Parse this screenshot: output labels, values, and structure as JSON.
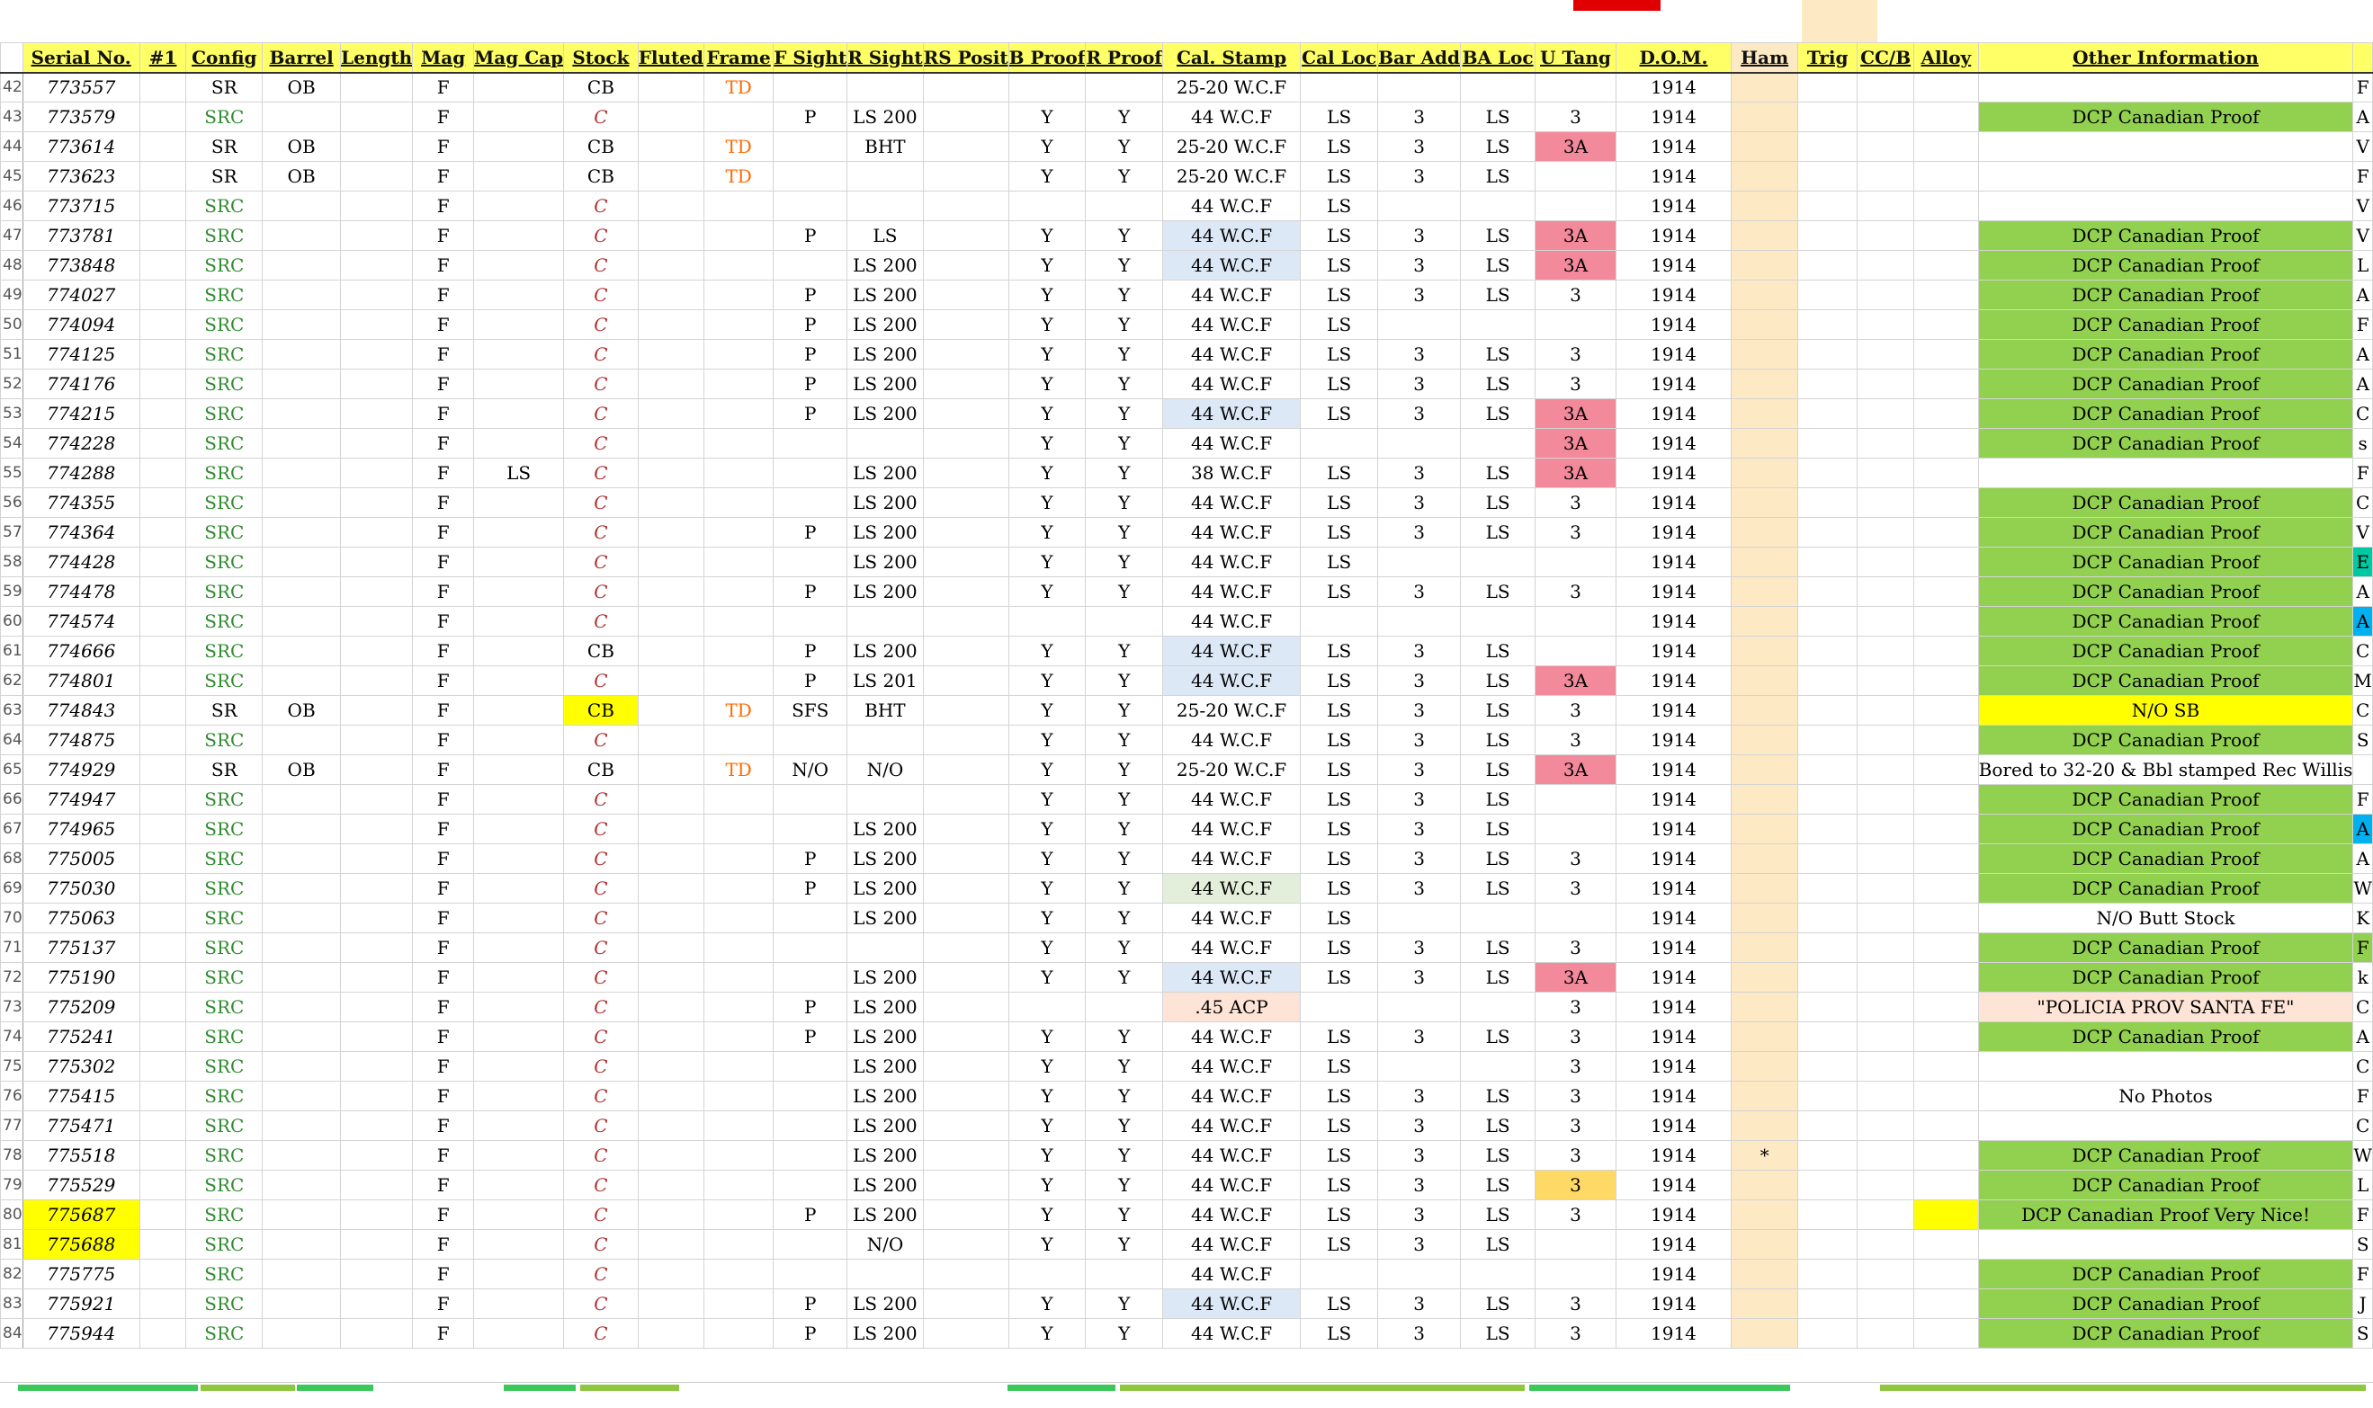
{
  "columns": [
    {
      "key": "rn",
      "label": ""
    },
    {
      "key": "ser",
      "label": "Serial No."
    },
    {
      "key": "num",
      "label": "#1"
    },
    {
      "key": "cfg",
      "label": "Config"
    },
    {
      "key": "bar",
      "label": "Barrel"
    },
    {
      "key": "len",
      "label": "Length"
    },
    {
      "key": "mag",
      "label": "Mag"
    },
    {
      "key": "mcap",
      "label": "Mag Cap"
    },
    {
      "key": "stk",
      "label": "Stock"
    },
    {
      "key": "flu",
      "label": "Fluted"
    },
    {
      "key": "frm",
      "label": "Frame"
    },
    {
      "key": "fs",
      "label": "F Sight"
    },
    {
      "key": "rs",
      "label": "R Sight"
    },
    {
      "key": "rsp",
      "label": "RS Posit"
    },
    {
      "key": "bp",
      "label": "B Proof"
    },
    {
      "key": "rp",
      "label": "R Proof"
    },
    {
      "key": "cal",
      "label": "Cal. Stamp"
    },
    {
      "key": "cl",
      "label": "Cal Loc"
    },
    {
      "key": "ba",
      "label": "Bar Add"
    },
    {
      "key": "bal",
      "label": "BA Loc"
    },
    {
      "key": "ut",
      "label": "U Tang"
    },
    {
      "key": "dom",
      "label": "D.O.M."
    },
    {
      "key": "ham",
      "label": "Ham"
    },
    {
      "key": "trg",
      "label": "Trig"
    },
    {
      "key": "ccb",
      "label": "CC/B"
    },
    {
      "key": "all",
      "label": "Alloy"
    },
    {
      "key": "oth",
      "label": "Other Information"
    },
    {
      "key": "edge",
      "label": ""
    }
  ],
  "rows": [
    {
      "rn": "42",
      "ser": "773557",
      "cfg": "SR",
      "bar": "OB",
      "mag": "F",
      "stk": "CB",
      "frm": "TD",
      "cal": "25-20 W.C.F",
      "dom": "1914",
      "edge": "F"
    },
    {
      "rn": "43",
      "ser": "773579",
      "cfg": "SRC",
      "mag": "F",
      "stk": "C",
      "fs": "P",
      "rs": "LS 200",
      "bp": "Y",
      "rp": "Y",
      "cal": "44 W.C.F",
      "cl": "LS",
      "ba": "3",
      "bal": "LS",
      "ut": "3",
      "dom": "1914",
      "oth": "DCP Canadian Proof",
      "oth_hl": "lime",
      "edge": "A"
    },
    {
      "rn": "44",
      "ser": "773614",
      "cfg": "SR",
      "bar": "OB",
      "mag": "F",
      "stk": "CB",
      "frm": "TD",
      "rs": "BHT",
      "bp": "Y",
      "rp": "Y",
      "cal": "25-20 W.C.F",
      "cl": "LS",
      "ba": "3",
      "bal": "LS",
      "ut": "3A",
      "ut_hl": "red",
      "dom": "1914",
      "edge": "V"
    },
    {
      "rn": "45",
      "ser": "773623",
      "cfg": "SR",
      "bar": "OB",
      "mag": "F",
      "stk": "CB",
      "frm": "TD",
      "bp": "Y",
      "rp": "Y",
      "cal": "25-20 W.C.F",
      "cl": "LS",
      "ba": "3",
      "bal": "LS",
      "dom": "1914",
      "edge": "F"
    },
    {
      "rn": "46",
      "ser": "773715",
      "cfg": "SRC",
      "mag": "F",
      "stk": "C",
      "cal": "44 W.C.F",
      "cl": "LS",
      "dom": "1914",
      "edge": "V"
    },
    {
      "rn": "47",
      "ser": "773781",
      "cfg": "SRC",
      "mag": "F",
      "stk": "C",
      "fs": "P",
      "rs": "LS",
      "bp": "Y",
      "rp": "Y",
      "cal": "44 W.C.F",
      "cal_hl": "blue",
      "cl": "LS",
      "ba": "3",
      "bal": "LS",
      "ut": "3A",
      "ut_hl": "red",
      "dom": "1914",
      "oth": "DCP Canadian Proof",
      "oth_hl": "lime",
      "edge": "V"
    },
    {
      "rn": "48",
      "ser": "773848",
      "cfg": "SRC",
      "mag": "F",
      "stk": "C",
      "rs": "LS 200",
      "bp": "Y",
      "rp": "Y",
      "cal": "44 W.C.F",
      "cal_hl": "blue",
      "cl": "LS",
      "ba": "3",
      "bal": "LS",
      "ut": "3A",
      "ut_hl": "red",
      "dom": "1914",
      "oth": "DCP Canadian Proof",
      "oth_hl": "lime",
      "edge": "L"
    },
    {
      "rn": "49",
      "ser": "774027",
      "cfg": "SRC",
      "mag": "F",
      "stk": "C",
      "fs": "P",
      "rs": "LS 200",
      "bp": "Y",
      "rp": "Y",
      "cal": "44 W.C.F",
      "cl": "LS",
      "ba": "3",
      "bal": "LS",
      "ut": "3",
      "dom": "1914",
      "oth": "DCP Canadian Proof",
      "oth_hl": "lime",
      "edge": "A"
    },
    {
      "rn": "50",
      "ser": "774094",
      "cfg": "SRC",
      "mag": "F",
      "stk": "C",
      "fs": "P",
      "rs": "LS 200",
      "bp": "Y",
      "rp": "Y",
      "cal": "44 W.C.F",
      "cl": "LS",
      "dom": "1914",
      "oth": "DCP Canadian Proof",
      "oth_hl": "lime",
      "edge": "F"
    },
    {
      "rn": "51",
      "ser": "774125",
      "cfg": "SRC",
      "mag": "F",
      "stk": "C",
      "fs": "P",
      "rs": "LS 200",
      "bp": "Y",
      "rp": "Y",
      "cal": "44 W.C.F",
      "cl": "LS",
      "ba": "3",
      "bal": "LS",
      "ut": "3",
      "dom": "1914",
      "oth": "DCP Canadian Proof",
      "oth_hl": "lime",
      "edge": "A"
    },
    {
      "rn": "52",
      "ser": "774176",
      "cfg": "SRC",
      "mag": "F",
      "stk": "C",
      "fs": "P",
      "rs": "LS 200",
      "bp": "Y",
      "rp": "Y",
      "cal": "44 W.C.F",
      "cl": "LS",
      "ba": "3",
      "bal": "LS",
      "ut": "3",
      "dom": "1914",
      "oth": "DCP Canadian Proof",
      "oth_hl": "lime",
      "edge": "A"
    },
    {
      "rn": "53",
      "ser": "774215",
      "cfg": "SRC",
      "mag": "F",
      "stk": "C",
      "fs": "P",
      "rs": "LS 200",
      "bp": "Y",
      "rp": "Y",
      "cal": "44 W.C.F",
      "cal_hl": "blue",
      "cl": "LS",
      "ba": "3",
      "bal": "LS",
      "ut": "3A",
      "ut_hl": "red",
      "dom": "1914",
      "oth": "DCP Canadian Proof",
      "oth_hl": "lime",
      "edge": "C"
    },
    {
      "rn": "54",
      "ser": "774228",
      "cfg": "SRC",
      "mag": "F",
      "stk": "C",
      "bp": "Y",
      "rp": "Y",
      "cal": "44 W.C.F",
      "ut": "3A",
      "ut_hl": "red",
      "dom": "1914",
      "oth": "DCP Canadian Proof",
      "oth_hl": "lime",
      "edge": "s"
    },
    {
      "rn": "55",
      "ser": "774288",
      "cfg": "SRC",
      "mag": "F",
      "mcap": "LS",
      "stk": "C",
      "rs": "LS 200",
      "bp": "Y",
      "rp": "Y",
      "cal": "38 W.C.F",
      "cl": "LS",
      "ba": "3",
      "bal": "LS",
      "ut": "3A",
      "ut_hl": "red",
      "dom": "1914",
      "edge": "F"
    },
    {
      "rn": "56",
      "ser": "774355",
      "cfg": "SRC",
      "mag": "F",
      "stk": "C",
      "rs": "LS 200",
      "bp": "Y",
      "rp": "Y",
      "cal": "44 W.C.F",
      "cl": "LS",
      "ba": "3",
      "bal": "LS",
      "ut": "3",
      "dom": "1914",
      "oth": "DCP Canadian Proof",
      "oth_hl": "lime",
      "edge": "C"
    },
    {
      "rn": "57",
      "ser": "774364",
      "cfg": "SRC",
      "mag": "F",
      "stk": "C",
      "fs": "P",
      "rs": "LS 200",
      "bp": "Y",
      "rp": "Y",
      "cal": "44 W.C.F",
      "cl": "LS",
      "ba": "3",
      "bal": "LS",
      "ut": "3",
      "dom": "1914",
      "oth": "DCP Canadian Proof",
      "oth_hl": "lime",
      "edge": "V"
    },
    {
      "rn": "58",
      "ser": "774428",
      "cfg": "SRC",
      "mag": "F",
      "stk": "C",
      "rs": "LS 200",
      "bp": "Y",
      "rp": "Y",
      "cal": "44 W.C.F",
      "cl": "LS",
      "dom": "1914",
      "oth": "DCP Canadian Proof",
      "oth_hl": "lime",
      "edge": "E",
      "edge_hl": "teal"
    },
    {
      "rn": "59",
      "ser": "774478",
      "cfg": "SRC",
      "mag": "F",
      "stk": "C",
      "fs": "P",
      "rs": "LS 200",
      "bp": "Y",
      "rp": "Y",
      "cal": "44 W.C.F",
      "cl": "LS",
      "ba": "3",
      "bal": "LS",
      "ut": "3",
      "dom": "1914",
      "oth": "DCP Canadian Proof",
      "oth_hl": "lime",
      "edge": "A"
    },
    {
      "rn": "60",
      "ser": "774574",
      "cfg": "SRC",
      "mag": "F",
      "stk": "C",
      "cal": "44 W.C.F",
      "dom": "1914",
      "oth": "DCP Canadian Proof",
      "oth_hl": "lime",
      "edge": "A",
      "edge_hl": "cyan"
    },
    {
      "rn": "61",
      "ser": "774666",
      "cfg": "SRC",
      "mag": "F",
      "stk": "CB",
      "fs": "P",
      "rs": "LS 200",
      "bp": "Y",
      "rp": "Y",
      "cal": "44 W.C.F",
      "cal_hl": "blue",
      "cl": "LS",
      "ba": "3",
      "bal": "LS",
      "dom": "1914",
      "oth": "DCP Canadian Proof",
      "oth_hl": "lime",
      "edge": "C"
    },
    {
      "rn": "62",
      "ser": "774801",
      "cfg": "SRC",
      "mag": "F",
      "stk": "C",
      "fs": "P",
      "rs": "LS 201",
      "bp": "Y",
      "rp": "Y",
      "cal": "44 W.C.F",
      "cal_hl": "blue",
      "cl": "LS",
      "ba": "3",
      "bal": "LS",
      "ut": "3A",
      "ut_hl": "red",
      "dom": "1914",
      "oth": "DCP Canadian Proof",
      "oth_hl": "lime",
      "edge": "M"
    },
    {
      "rn": "63",
      "ser": "774843",
      "cfg": "SR",
      "bar": "OB",
      "mag": "F",
      "stk": "CB",
      "stk_hl": "yellow",
      "frm": "TD",
      "fs": "SFS",
      "rs": "BHT",
      "bp": "Y",
      "rp": "Y",
      "cal": "25-20 W.C.F",
      "cl": "LS",
      "ba": "3",
      "bal": "LS",
      "ut": "3",
      "dom": "1914",
      "oth": "N/O SB",
      "oth_hl": "yellow",
      "edge": "C"
    },
    {
      "rn": "64",
      "ser": "774875",
      "cfg": "SRC",
      "mag": "F",
      "stk": "C",
      "bp": "Y",
      "rp": "Y",
      "cal": "44 W.C.F",
      "cl": "LS",
      "ba": "3",
      "bal": "LS",
      "ut": "3",
      "dom": "1914",
      "oth": "DCP Canadian Proof",
      "oth_hl": "lime",
      "edge": "S"
    },
    {
      "rn": "65",
      "ser": "774929",
      "cfg": "SR",
      "bar": "OB",
      "mag": "F",
      "stk": "CB",
      "frm": "TD",
      "fs": "N/O",
      "rs": "N/O",
      "bp": "Y",
      "rp": "Y",
      "cal": "25-20 W.C.F",
      "cl": "LS",
      "ba": "3",
      "bal": "LS",
      "ut": "3A",
      "ut_hl": "red",
      "dom": "1914",
      "oth": "Bored to 32-20 & Bbl stamped  Rec Willis"
    },
    {
      "rn": "66",
      "ser": "774947",
      "cfg": "SRC",
      "mag": "F",
      "stk": "C",
      "bp": "Y",
      "rp": "Y",
      "cal": "44 W.C.F",
      "cl": "LS",
      "ba": "3",
      "bal": "LS",
      "dom": "1914",
      "oth": "DCP Canadian Proof",
      "oth_hl": "lime",
      "edge": "F"
    },
    {
      "rn": "67",
      "ser": "774965",
      "cfg": "SRC",
      "mag": "F",
      "stk": "C",
      "rs": "LS 200",
      "bp": "Y",
      "rp": "Y",
      "cal": "44 W.C.F",
      "cl": "LS",
      "ba": "3",
      "bal": "LS",
      "dom": "1914",
      "oth": "DCP Canadian Proof",
      "oth_hl": "lime",
      "edge": "A",
      "edge_hl": "cyan"
    },
    {
      "rn": "68",
      "ser": "775005",
      "cfg": "SRC",
      "mag": "F",
      "stk": "C",
      "fs": "P",
      "rs": "LS 200",
      "bp": "Y",
      "rp": "Y",
      "cal": "44 W.C.F",
      "cl": "LS",
      "ba": "3",
      "bal": "LS",
      "ut": "3",
      "dom": "1914",
      "oth": "DCP Canadian Proof",
      "oth_hl": "lime",
      "edge": "A"
    },
    {
      "rn": "69",
      "ser": "775030",
      "cfg": "SRC",
      "mag": "F",
      "stk": "C",
      "fs": "P",
      "rs": "LS 200",
      "bp": "Y",
      "rp": "Y",
      "cal": "44 W.C.F",
      "cal_hl": "green",
      "cl": "LS",
      "ba": "3",
      "bal": "LS",
      "ut": "3",
      "dom": "1914",
      "oth": "DCP Canadian Proof",
      "oth_hl": "lime",
      "edge": "W"
    },
    {
      "rn": "70",
      "ser": "775063",
      "cfg": "SRC",
      "mag": "F",
      "stk": "C",
      "rs": "LS 200",
      "bp": "Y",
      "rp": "Y",
      "cal": "44 W.C.F",
      "cl": "LS",
      "dom": "1914",
      "oth": "N/O Butt Stock",
      "edge": "K"
    },
    {
      "rn": "71",
      "ser": "775137",
      "cfg": "SRC",
      "mag": "F",
      "stk": "C",
      "bp": "Y",
      "rp": "Y",
      "cal": "44 W.C.F",
      "cl": "LS",
      "ba": "3",
      "bal": "LS",
      "ut": "3",
      "dom": "1914",
      "oth": "DCP Canadian Proof",
      "oth_hl": "lime",
      "edge": "F",
      "edge_hl": "lime"
    },
    {
      "rn": "72",
      "ser": "775190",
      "cfg": "SRC",
      "mag": "F",
      "stk": "C",
      "rs": "LS 200",
      "bp": "Y",
      "rp": "Y",
      "cal": "44 W.C.F",
      "cal_hl": "blue",
      "cl": "LS",
      "ba": "3",
      "bal": "LS",
      "ut": "3A",
      "ut_hl": "red",
      "dom": "1914",
      "oth": "DCP Canadian Proof",
      "oth_hl": "lime",
      "edge": "k"
    },
    {
      "rn": "73",
      "ser": "775209",
      "cfg": "SRC",
      "mag": "F",
      "stk": "C",
      "fs": "P",
      "rs": "LS 200",
      "cal": ".45 ACP",
      "cal_hl": "peach",
      "ut": "3",
      "dom": "1914",
      "oth": "\"POLICIA  PROV SANTA FE\"",
      "oth_hl": "peach",
      "edge": "C"
    },
    {
      "rn": "74",
      "ser": "775241",
      "cfg": "SRC",
      "mag": "F",
      "stk": "C",
      "fs": "P",
      "rs": "LS 200",
      "bp": "Y",
      "rp": "Y",
      "cal": "44 W.C.F",
      "cl": "LS",
      "ba": "3",
      "bal": "LS",
      "ut": "3",
      "dom": "1914",
      "oth": "DCP Canadian Proof",
      "oth_hl": "lime",
      "edge": "A"
    },
    {
      "rn": "75",
      "ser": "775302",
      "cfg": "SRC",
      "mag": "F",
      "stk": "C",
      "rs": "LS 200",
      "bp": "Y",
      "rp": "Y",
      "cal": "44 W.C.F",
      "cl": "LS",
      "ut": "3",
      "dom": "1914",
      "edge": "C"
    },
    {
      "rn": "76",
      "ser": "775415",
      "cfg": "SRC",
      "mag": "F",
      "stk": "C",
      "rs": "LS 200",
      "bp": "Y",
      "rp": "Y",
      "cal": "44 W.C.F",
      "cl": "LS",
      "ba": "3",
      "bal": "LS",
      "ut": "3",
      "dom": "1914",
      "oth": "No Photos",
      "edge": "F"
    },
    {
      "rn": "77",
      "ser": "775471",
      "cfg": "SRC",
      "mag": "F",
      "stk": "C",
      "rs": "LS 200",
      "bp": "Y",
      "rp": "Y",
      "cal": "44 W.C.F",
      "cl": "LS",
      "ba": "3",
      "bal": "LS",
      "ut": "3",
      "dom": "1914",
      "edge": "C"
    },
    {
      "rn": "78",
      "ser": "775518",
      "cfg": "SRC",
      "mag": "F",
      "stk": "C",
      "rs": "LS 200",
      "bp": "Y",
      "rp": "Y",
      "cal": "44 W.C.F",
      "cl": "LS",
      "ba": "3",
      "bal": "LS",
      "ut": "3",
      "dom": "1914",
      "ham": "*",
      "oth": "DCP Canadian Proof",
      "oth_hl": "lime",
      "edge": "W"
    },
    {
      "rn": "79",
      "ser": "775529",
      "cfg": "SRC",
      "mag": "F",
      "stk": "C",
      "rs": "LS 200",
      "bp": "Y",
      "rp": "Y",
      "cal": "44 W.C.F",
      "cl": "LS",
      "ba": "3",
      "bal": "LS",
      "ut": "3",
      "ut_hl": "orange",
      "dom": "1914",
      "oth": "DCP Canadian Proof",
      "oth_hl": "lime",
      "edge": "L"
    },
    {
      "rn": "80",
      "ser": "775687",
      "ser_hl": "yellow",
      "cfg": "SRC",
      "mag": "F",
      "stk": "C",
      "fs": "P",
      "rs": "LS 200",
      "bp": "Y",
      "rp": "Y",
      "cal": "44 W.C.F",
      "cl": "LS",
      "ba": "3",
      "bal": "LS",
      "ut": "3",
      "dom": "1914",
      "all_hl": "yellow",
      "oth": "DCP Canadian Proof   Very Nice!",
      "oth_hl": "lime",
      "edge": "F"
    },
    {
      "rn": "81",
      "ser": "775688",
      "ser_hl": "yellow",
      "cfg": "SRC",
      "mag": "F",
      "stk": "C",
      "rs": "N/O",
      "bp": "Y",
      "rp": "Y",
      "cal": "44 W.C.F",
      "cl": "LS",
      "ba": "3",
      "bal": "LS",
      "dom": "1914",
      "edge": "S"
    },
    {
      "rn": "82",
      "ser": "775775",
      "cfg": "SRC",
      "mag": "F",
      "stk": "C",
      "cal": "44 W.C.F",
      "dom": "1914",
      "oth": "DCP Canadian Proof",
      "oth_hl": "lime",
      "edge": "F"
    },
    {
      "rn": "83",
      "ser": "775921",
      "cfg": "SRC",
      "mag": "F",
      "stk": "C",
      "fs": "P",
      "rs": "LS 200",
      "bp": "Y",
      "rp": "Y",
      "cal": "44 W.C.F",
      "cal_hl": "blue",
      "cl": "LS",
      "ba": "3",
      "bal": "LS",
      "ut": "3",
      "dom": "1914",
      "oth": "DCP Canadian Proof",
      "oth_hl": "lime",
      "edge": "J"
    },
    {
      "rn": "84",
      "ser": "775944",
      "cfg": "SRC",
      "mag": "F",
      "stk": "C",
      "fs": "P",
      "rs": "LS 200",
      "bp": "Y",
      "rp": "Y",
      "cal": "44 W.C.F",
      "cl": "LS",
      "ba": "3",
      "bal": "LS",
      "ut": "3",
      "dom": "1914",
      "oth": "DCP Canadian Proof",
      "oth_hl": "lime",
      "edge": "S"
    }
  ],
  "colors": {
    "header_bg": "#ffff66",
    "ham_column": "#fde9c4",
    "src_text": "#2e8b2e",
    "frame_td_text": "#ff6a00",
    "stock_c_text": "#b03030",
    "highlight_lime": "#92d050",
    "highlight_red": "#f28a9c",
    "highlight_blue": "#dce8f6",
    "highlight_yellow": "#ffff00",
    "highlight_peach": "#fde4d6",
    "highlight_orange": "#ffd966",
    "highlight_teal": "#00c8a0",
    "highlight_cyan": "#00b0f0"
  }
}
